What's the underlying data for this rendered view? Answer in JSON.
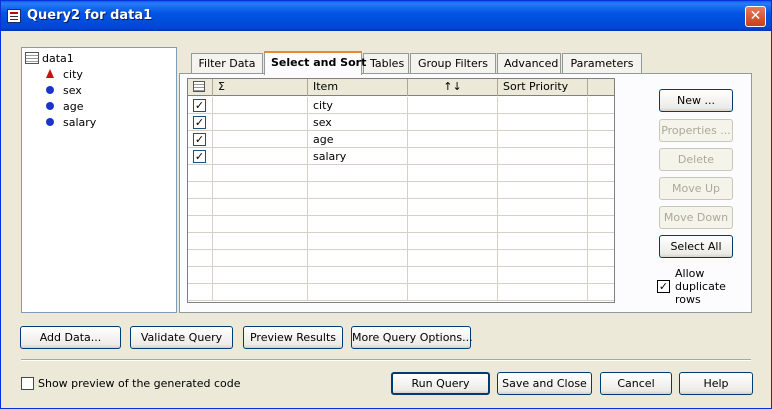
{
  "window": {
    "title": "Query2 for data1",
    "close_glyph": "✕"
  },
  "tree": {
    "root": "data1",
    "items": [
      {
        "label": "city",
        "icon": "flame-icon"
      },
      {
        "label": "sex",
        "icon": "bullet-icon"
      },
      {
        "label": "age",
        "icon": "bullet-icon"
      },
      {
        "label": "salary",
        "icon": "bullet-icon"
      }
    ]
  },
  "tabs": [
    {
      "label": "Filter Data"
    },
    {
      "label": "Select and Sort"
    },
    {
      "label": "Tables"
    },
    {
      "label": "Group Filters"
    },
    {
      "label": "Advanced"
    },
    {
      "label": "Parameters"
    }
  ],
  "active_tab": "Select and Sort",
  "grid": {
    "headers": {
      "sum": "Σ",
      "item": "Item",
      "sort": "↑↓",
      "priority": "Sort Priority"
    },
    "rows": [
      {
        "checked": true,
        "item": "city"
      },
      {
        "checked": true,
        "item": "sex"
      },
      {
        "checked": true,
        "item": "age"
      },
      {
        "checked": true,
        "item": "salary"
      }
    ],
    "check_glyph": "✓"
  },
  "side_buttons": {
    "new": "New ...",
    "properties": "Properties ...",
    "delete": "Delete",
    "move_up": "Move Up",
    "move_down": "Move Down",
    "select_all": "Select All"
  },
  "allow_duplicates": {
    "label": "Allow duplicate rows",
    "checked": true
  },
  "bottom_buttons": {
    "add_data": "Add Data...",
    "validate": "Validate Query",
    "preview": "Preview Results",
    "more_options": "More Query Options..."
  },
  "footer": {
    "show_preview_label": "Show preview of the generated code",
    "show_preview_checked": false,
    "run_query": "Run Query",
    "save_close": "Save and Close",
    "cancel": "Cancel",
    "help": "Help"
  }
}
